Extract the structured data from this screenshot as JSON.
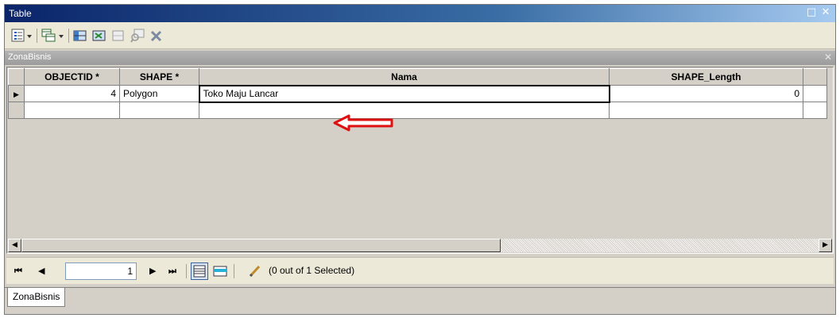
{
  "window": {
    "title": "Table",
    "maximize_icon": "maximize-icon",
    "close_icon": "close-icon"
  },
  "toolbar": {
    "items": [
      "table-options-icon",
      "related-tables-icon",
      "select-by-attributes-icon",
      "switch-selection-icon",
      "clear-selection-icon",
      "zoom-to-selected-icon",
      "delete-selected-icon"
    ]
  },
  "table_tab": {
    "name": "ZonaBisnis"
  },
  "grid": {
    "columns": [
      "OBJECTID *",
      "SHAPE *",
      "Nama",
      "SHAPE_Length"
    ],
    "rows": [
      {
        "objectid": "4",
        "shape": "Polygon",
        "nama": "Toko Maju Lancar",
        "shape_length": "0"
      },
      {
        "objectid": "",
        "shape": "",
        "nama": "",
        "shape_length": ""
      }
    ],
    "row_pointer_icon": "row-pointer-icon"
  },
  "annotation": {
    "arrow_color": "#ff0000"
  },
  "navigation": {
    "current_record": "1",
    "selection_info": "(0 out of 1 Selected)"
  },
  "tabs": [
    {
      "label": "ZonaBisnis",
      "active": true
    }
  ]
}
